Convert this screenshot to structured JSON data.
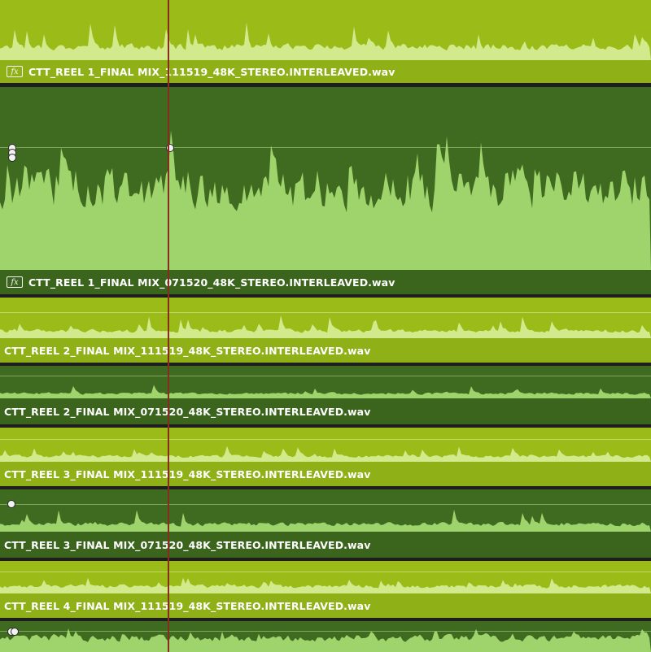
{
  "colors": {
    "clip_light": "#9bbb18",
    "clip_light_wave": "#d3ea8c",
    "clip_light_bar": "#8fb016",
    "clip_dark": "#3f6b20",
    "clip_dark_wave": "#9fd36b",
    "clip_dark_bar": "#3b651d",
    "playhead": "#8a2b1f",
    "separator": "#1e1e1e"
  },
  "tracks": [
    {
      "id": "a1",
      "label": "CTT_REEL 1_FINAL MIX_111519_48K_STEREO.INTERLEAVED.wav",
      "has_fx": true,
      "fx_label": "fx",
      "style": "light"
    },
    {
      "id": "b1",
      "label": "CTT_REEL 1_FINAL MIX_071520_48K_STEREO.INTERLEAVED.wav",
      "has_fx": true,
      "fx_label": "fx",
      "style": "dark"
    },
    {
      "id": "a2",
      "label": "CTT_REEL 2_FINAL MIX_111519_48K_STEREO.INTERLEAVED.wav",
      "has_fx": false,
      "style": "light"
    },
    {
      "id": "b2",
      "label": "CTT_REEL 2_FINAL MIX_071520_48K_STEREO.INTERLEAVED.wav",
      "has_fx": false,
      "style": "dark"
    },
    {
      "id": "a3",
      "label": "CTT_REEL 3_FINAL MIX_111519_48K_STEREO.INTERLEAVED.wav",
      "has_fx": false,
      "style": "light"
    },
    {
      "id": "b3",
      "label": "CTT_REEL 3_FINAL MIX_071520_48K_STEREO.INTERLEAVED.wav",
      "has_fx": false,
      "style": "dark"
    },
    {
      "id": "a4",
      "label": "CTT_REEL 4_FINAL MIX_111519_48K_STEREO.INTERLEAVED.wav",
      "has_fx": false,
      "style": "light"
    },
    {
      "id": "b4",
      "label": "",
      "has_fx": false,
      "style": "dark"
    }
  ]
}
